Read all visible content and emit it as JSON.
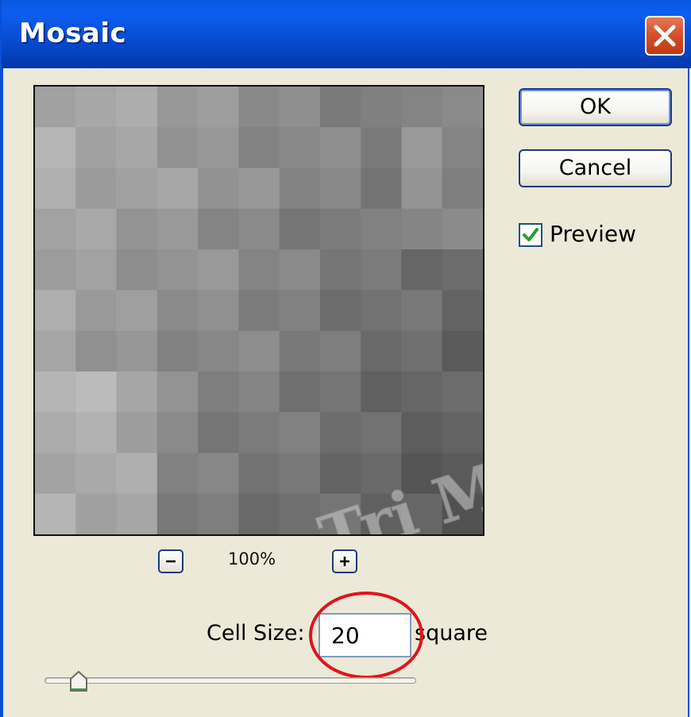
{
  "window": {
    "title": "Mosaic"
  },
  "buttons": {
    "ok_label": "OK",
    "cancel_label": "Cancel"
  },
  "preview_option": {
    "label": "Preview",
    "checked": true
  },
  "zoom": {
    "level": "100%",
    "zoom_out_icon": "minus-icon",
    "zoom_in_icon": "plus-icon"
  },
  "cell_size": {
    "label": "Cell Size:",
    "value": "20",
    "unit": "square",
    "slider_fraction": 0.085
  },
  "watermark": {
    "text": "Quản Trị Mạng"
  },
  "colors": {
    "titlebar": "#0a58e0",
    "close_button": "#d34a24",
    "dialog_bg": "#ece9d8",
    "check_mark": "#22a02a",
    "annotation_circle": "#e0141c"
  }
}
